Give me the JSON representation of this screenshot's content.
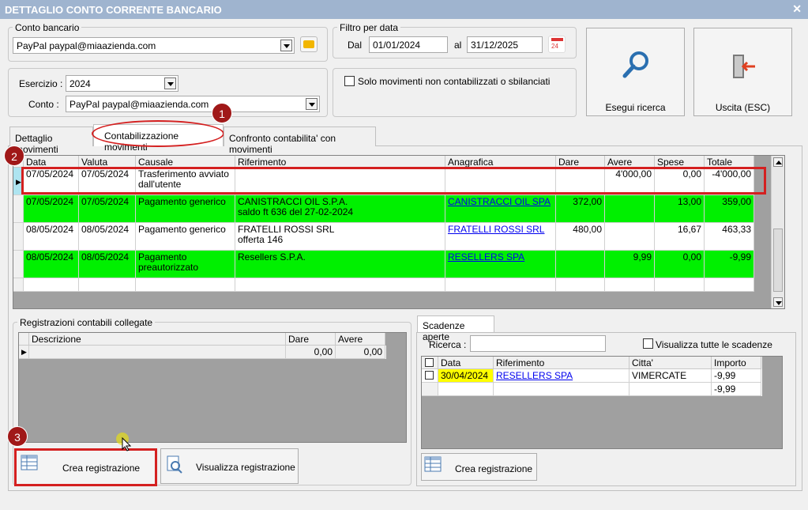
{
  "window": {
    "title": "DETTAGLIO CONTO CORRENTE BANCARIO",
    "close": "✕"
  },
  "conto_bancario": {
    "legend": "Conto bancario",
    "value": "PayPal paypal@miaazienda.com"
  },
  "filtro": {
    "legend": "Filtro per data",
    "dal_label": "Dal",
    "dal": "01/01/2024",
    "al_label": "al",
    "al": "31/12/2025",
    "cal_icon_text": "24"
  },
  "esercizio": {
    "label": "Esercizio :",
    "value": "2024",
    "conto_label": "Conto :",
    "conto_value": "PayPal paypal@miaazienda.com"
  },
  "solo_movimenti": {
    "label": "Solo movimenti non contabilizzati o sbilanciati"
  },
  "buttons": {
    "search": "Esegui ricerca",
    "exit": "Uscita (ESC)"
  },
  "tabs": [
    "Dettaglio movimenti",
    "Contabilizzazione movimenti",
    "Confronto contabilita' con movimenti"
  ],
  "badges": [
    "1",
    "2",
    "3"
  ],
  "movimenti": {
    "columns": [
      "Data",
      "Valuta",
      "Causale",
      "Riferimento",
      "Anagrafica",
      "Dare",
      "Avere",
      "Spese",
      "Totale"
    ],
    "rows": [
      {
        "data": "07/05/2024",
        "valuta": "07/05/2024",
        "causale": "Trasferimento avviato\ndall'utente",
        "riferimento": "",
        "anagrafica": "",
        "dare": "",
        "avere": "4'000,00",
        "spese": "0,00",
        "totale": "-4'000,00",
        "color": "#ffffff"
      },
      {
        "data": "07/05/2024",
        "valuta": "07/05/2024",
        "causale": "Pagamento generico",
        "riferimento": "CANISTRACCI OIL S.P.A.\nsaldo ft 636 del 27-02-2024",
        "anagrafica": "CANISTRACCI OIL SPA",
        "dare": "372,00",
        "avere": "",
        "spese": "13,00",
        "totale": "359,00",
        "color": "#00f000"
      },
      {
        "data": "08/05/2024",
        "valuta": "08/05/2024",
        "causale": "Pagamento generico",
        "riferimento": "FRATELLI ROSSI SRL\nofferta 146",
        "anagrafica": "FRATELLI ROSSI SRL",
        "dare": "480,00",
        "avere": "",
        "spese": "16,67",
        "totale": "463,33",
        "color": "#ffffff"
      },
      {
        "data": "08/05/2024",
        "valuta": "08/05/2024",
        "causale": "Pagamento\npreautorizzato",
        "riferimento": "Resellers S.P.A.",
        "anagrafica": "RESELLERS SPA",
        "dare": "",
        "avere": "9,99",
        "spese": "0,00",
        "totale": "-9,99",
        "color": "#00f000"
      }
    ]
  },
  "registrazioni": {
    "legend": "Registrazioni contabili collegate",
    "columns": [
      "Descrizione",
      "Dare",
      "Avere"
    ],
    "row": {
      "descrizione": "",
      "dare": "0,00",
      "avere": "0,00"
    },
    "crea": "Crea registrazione",
    "visualizza": "Visualizza registrazione"
  },
  "scadenze": {
    "tab": "Scadenze aperte",
    "ricerca_label": "Ricerca :",
    "ricerca_value": "",
    "visualizza_tutte": "Visualizza tutte le scadenze",
    "columns": [
      "Data scad...",
      "Riferimento",
      "Citta'",
      "Importo"
    ],
    "rows": [
      {
        "data": "30/04/2024",
        "riferimento": "RESELLERS SPA",
        "citta": "VIMERCATE (MB)",
        "importo": "-9,99"
      }
    ],
    "total": "-9,99",
    "crea": "Crea registrazione"
  },
  "colors": {
    "highlight_green": "#00f000",
    "red_frame": "#d42020",
    "badge": "#a01818",
    "date_yellow": "#ffff00"
  }
}
